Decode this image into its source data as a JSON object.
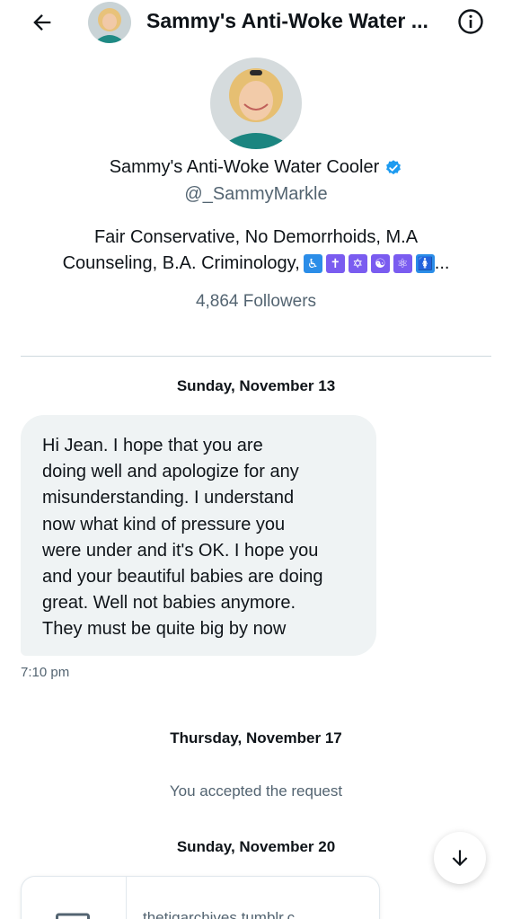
{
  "header": {
    "title": "Sammy's Anti-Woke Water ...",
    "back_icon": "arrow-left-icon",
    "info_icon": "info-circle-icon"
  },
  "profile": {
    "name": "Sammy's Anti-Woke Water Cooler",
    "verified": true,
    "handle": "@_SammyMarkle",
    "bio_line1": "Fair Conservative, No Demorrhoids, M.A",
    "bio_line2": "Counseling, B.A. Criminology,",
    "bio_emojis": [
      "♿",
      "✝",
      "✡",
      "☯",
      "⚛",
      "🚺"
    ],
    "bio_more": "...",
    "followers": "4,864 Followers"
  },
  "conversation": {
    "date1": "Sunday, November 13",
    "message1": {
      "lines": [
        "Hi Jean. I hope that you are",
        "doing well and apologize for any",
        "misunderstanding. I understand",
        "now what kind of pressure you",
        "were under and it's OK. I hope you",
        "and your beautiful babies are doing",
        "great. Well not babies anymore.",
        "They must be quite big by now"
      ],
      "time": "7:10 pm"
    },
    "date2": "Thursday, November 17",
    "system_message": "You accepted the request",
    "date3": "Sunday, November 20",
    "link_card": {
      "domain": "thetigarchives.tumblr.c"
    }
  },
  "scroll_down_icon": "arrow-down-icon",
  "colors": {
    "accent": "#1d9bf0",
    "secondary_text": "#536471",
    "bubble_bg": "#eff3f4"
  }
}
